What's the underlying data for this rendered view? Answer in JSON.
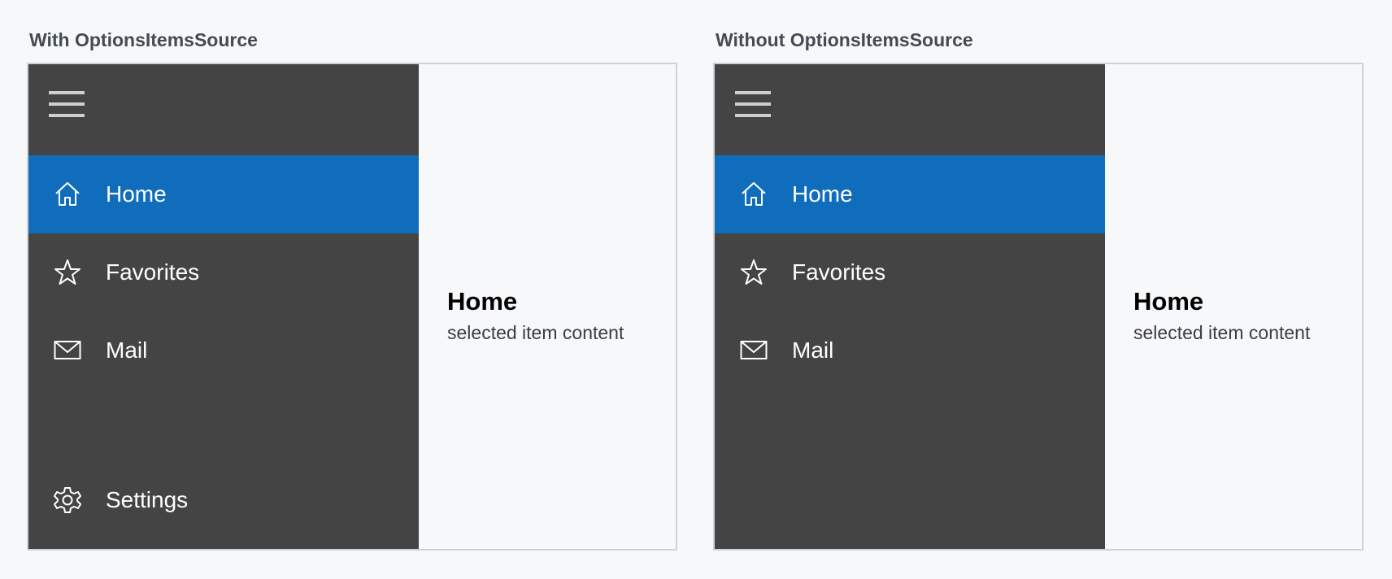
{
  "panels": [
    {
      "title": "With OptionsItemsSource",
      "nav_items": [
        {
          "label": "Home",
          "icon": "home-icon",
          "selected": true
        },
        {
          "label": "Favorites",
          "icon": "star-icon",
          "selected": false
        },
        {
          "label": "Mail",
          "icon": "mail-icon",
          "selected": false
        }
      ],
      "options_items": [
        {
          "label": "Settings",
          "icon": "gear-icon"
        }
      ],
      "content": {
        "title": "Home",
        "subtitle": "selected item content"
      }
    },
    {
      "title": "Without OptionsItemsSource",
      "nav_items": [
        {
          "label": "Home",
          "icon": "home-icon",
          "selected": true
        },
        {
          "label": "Favorites",
          "icon": "star-icon",
          "selected": false
        },
        {
          "label": "Mail",
          "icon": "mail-icon",
          "selected": false
        }
      ],
      "options_items": [],
      "content": {
        "title": "Home",
        "subtitle": "selected item content"
      }
    }
  ],
  "colors": {
    "pane_background": "#444444",
    "selected_background": "#0f6dbb",
    "content_background": "#f7f8fa"
  }
}
